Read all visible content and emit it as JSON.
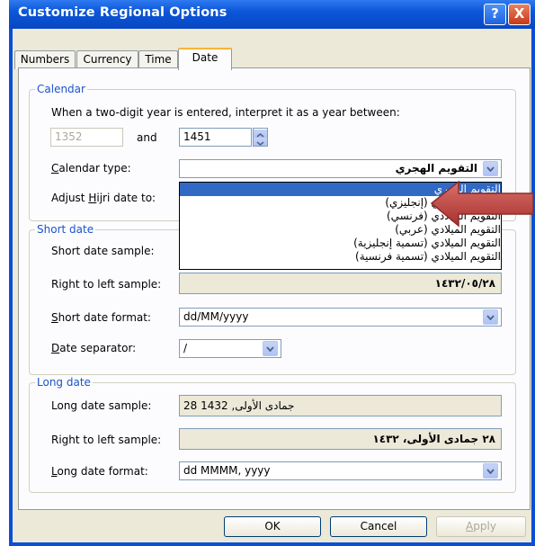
{
  "window": {
    "title": "Customize Regional Options",
    "help_glyph": "?",
    "close_glyph": "X"
  },
  "tabs": [
    {
      "label": "Numbers",
      "active": false
    },
    {
      "label": "Currency",
      "active": false
    },
    {
      "label": "Time",
      "active": false
    },
    {
      "label": "Date",
      "active": true
    }
  ],
  "calendar": {
    "legend": "Calendar",
    "two_digit_text": "When a two-digit year is entered, interpret it as a year between:",
    "year_from": "1352",
    "and_label": "and",
    "year_to": "1451",
    "type_label": "Calendar type:",
    "type_value": "التقويم الهجري",
    "adjust_label": "Adjust Hijri date to:",
    "options": [
      "التقويم الهجري",
      "التقويم الميلادي (إنجليزي)",
      "التقويم الميلادي (فرنسي)",
      "التقويم الميلادي (عربي)",
      "التقويم الميلادي (تسمية إنجليزية)",
      "التقويم الميلادي (تسمية فرنسية)"
    ],
    "selected_option_index": 0
  },
  "short_date": {
    "legend": "Short date",
    "sample_label": "Short date sample:",
    "rtl_label": "Right to left sample:",
    "rtl_value": "١٤٣٢/٠٥/٢٨",
    "format_label": "Short date format:",
    "format_value": "dd/MM/yyyy",
    "separator_label": "Date separator:",
    "separator_value": "/"
  },
  "long_date": {
    "legend": "Long date",
    "sample_label": "Long date sample:",
    "sample_value": "28 جمادى الأولى, 1432",
    "rtl_label": "Right to left sample:",
    "rtl_value": "٢٨ جمادى الأولى، ١٤٣٢",
    "format_label": "Long date format:",
    "format_value": "dd MMMM, yyyy"
  },
  "buttons": {
    "ok": "OK",
    "cancel": "Cancel",
    "apply": "Apply"
  },
  "colors": {
    "titlebar": "#0b56d8",
    "dialog": "#ece9d8",
    "selection": "#316ac5",
    "arrow": "#c0504d",
    "legend": "#1b54c8"
  }
}
